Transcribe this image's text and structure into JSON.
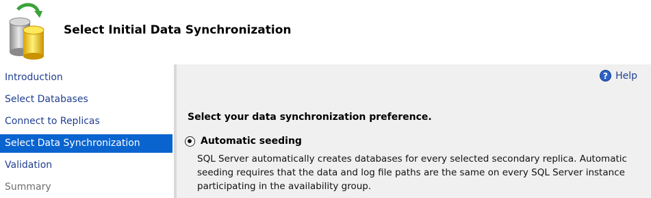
{
  "header": {
    "title": "Select Initial Data Synchronization",
    "icon": "database-sync-icon"
  },
  "nav": {
    "items": [
      {
        "label": "Introduction",
        "state": "normal"
      },
      {
        "label": "Select Databases",
        "state": "normal"
      },
      {
        "label": "Connect to Replicas",
        "state": "normal"
      },
      {
        "label": "Select Data Synchronization",
        "state": "selected"
      },
      {
        "label": "Validation",
        "state": "normal"
      },
      {
        "label": "Summary",
        "state": "disabled"
      }
    ]
  },
  "main": {
    "help_label": "Help",
    "prompt": "Select your data synchronization preference.",
    "option": {
      "label": "Automatic seeding",
      "selected": true,
      "description": "SQL Server automatically creates databases for every selected secondary replica. Automatic seeding requires that the data and log file paths are the same on every SQL Server instance participating in the availability group."
    }
  },
  "colors": {
    "selected_bg": "#0a64d0",
    "link": "#1f3e8f",
    "panel_bg": "#f0f0f0"
  }
}
